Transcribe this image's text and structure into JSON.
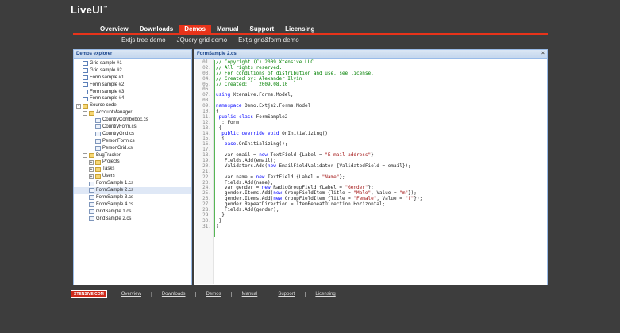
{
  "logo": {
    "text": "LiveUI",
    "sup": "™"
  },
  "topnav": [
    {
      "label": "Overview"
    },
    {
      "label": "Downloads"
    },
    {
      "label": "Demos",
      "active": true
    },
    {
      "label": "Manual"
    },
    {
      "label": "Support"
    },
    {
      "label": "Licensing"
    }
  ],
  "subnav": [
    {
      "label": "Extjs tree demo"
    },
    {
      "label": "JQuery grid demo"
    },
    {
      "label": "Extjs grid&form demo"
    }
  ],
  "explorer": {
    "title": "Demos explorer",
    "nodes": [
      {
        "label": "Grid sample #1",
        "depth": 0,
        "icon": "file",
        "exp": ""
      },
      {
        "label": "Grid sample #2",
        "depth": 0,
        "icon": "file",
        "exp": ""
      },
      {
        "label": "Form sample #1",
        "depth": 0,
        "icon": "file",
        "exp": ""
      },
      {
        "label": "Form sample #2",
        "depth": 0,
        "icon": "file",
        "exp": ""
      },
      {
        "label": "Form sample #3",
        "depth": 0,
        "icon": "file",
        "exp": ""
      },
      {
        "label": "Form sample #4",
        "depth": 0,
        "icon": "file",
        "exp": ""
      },
      {
        "label": "Source code",
        "depth": 0,
        "icon": "folder",
        "exp": "-"
      },
      {
        "label": "AccountManager",
        "depth": 1,
        "icon": "folder",
        "exp": "-"
      },
      {
        "label": "CountryCombobox.cs",
        "depth": 2,
        "icon": "cs",
        "exp": ""
      },
      {
        "label": "CountryForm.cs",
        "depth": 2,
        "icon": "cs",
        "exp": ""
      },
      {
        "label": "CountryGrid.cs",
        "depth": 2,
        "icon": "cs",
        "exp": ""
      },
      {
        "label": "PersonForm.cs",
        "depth": 2,
        "icon": "cs",
        "exp": ""
      },
      {
        "label": "PersonGrid.cs",
        "depth": 2,
        "icon": "cs",
        "exp": ""
      },
      {
        "label": "BugTracker",
        "depth": 1,
        "icon": "folder",
        "exp": "-"
      },
      {
        "label": "Projects",
        "depth": 2,
        "icon": "folder",
        "exp": "+"
      },
      {
        "label": "Tasks",
        "depth": 2,
        "icon": "folder",
        "exp": "+"
      },
      {
        "label": "Users",
        "depth": 2,
        "icon": "folder",
        "exp": "+"
      },
      {
        "label": "FormSample 1.cs",
        "depth": 1,
        "icon": "cs",
        "exp": ""
      },
      {
        "label": "FormSample 2.cs",
        "depth": 1,
        "icon": "cs",
        "exp": "",
        "selected": true
      },
      {
        "label": "FormSample 3.cs",
        "depth": 1,
        "icon": "cs",
        "exp": ""
      },
      {
        "label": "FormSample 4.cs",
        "depth": 1,
        "icon": "cs",
        "exp": ""
      },
      {
        "label": "GridSample 1.cs",
        "depth": 1,
        "icon": "cs",
        "exp": ""
      },
      {
        "label": "GridSample 2.cs",
        "depth": 1,
        "icon": "cs",
        "exp": ""
      }
    ]
  },
  "editor": {
    "title": "FormSample 2.cs",
    "close": "×",
    "lines": [
      {
        "n": "01.",
        "parts": [
          [
            "c-comment",
            "// Copyright (C) 2009 Xtensive LLC."
          ]
        ]
      },
      {
        "n": "02.",
        "parts": [
          [
            "c-comment",
            "// All rights reserved."
          ]
        ]
      },
      {
        "n": "03.",
        "parts": [
          [
            "c-comment",
            "// For conditions of distribution and use, see license."
          ]
        ]
      },
      {
        "n": "04.",
        "parts": [
          [
            "c-comment",
            "// Created by: Alexander Ilyin"
          ]
        ]
      },
      {
        "n": "05.",
        "parts": [
          [
            "c-comment",
            "// Created:    2009.08.10"
          ]
        ]
      },
      {
        "n": "06.",
        "parts": [
          [
            "c-plain",
            ""
          ]
        ]
      },
      {
        "n": "07.",
        "parts": [
          [
            "c-kw",
            "using"
          ],
          [
            "c-plain",
            " Xtensive.Forms.Model;"
          ]
        ]
      },
      {
        "n": "08.",
        "parts": [
          [
            "c-plain",
            ""
          ]
        ]
      },
      {
        "n": "09.",
        "parts": [
          [
            "c-kw",
            "namespace"
          ],
          [
            "c-plain",
            " Demo.Extjs2.Forms.Model"
          ]
        ]
      },
      {
        "n": "10.",
        "parts": [
          [
            "c-plain",
            "{"
          ]
        ]
      },
      {
        "n": "11.",
        "parts": [
          [
            "c-plain",
            " "
          ],
          [
            "c-kw",
            "public"
          ],
          [
            "c-plain",
            " "
          ],
          [
            "c-kw",
            "class"
          ],
          [
            "c-plain",
            " FormSample2"
          ]
        ]
      },
      {
        "n": "12.",
        "parts": [
          [
            "c-plain",
            "  : Form"
          ]
        ]
      },
      {
        "n": "13.",
        "parts": [
          [
            "c-plain",
            " {"
          ]
        ]
      },
      {
        "n": "14.",
        "parts": [
          [
            "c-plain",
            "  "
          ],
          [
            "c-kw",
            "public"
          ],
          [
            "c-plain",
            " "
          ],
          [
            "c-kw",
            "override"
          ],
          [
            "c-plain",
            " "
          ],
          [
            "c-kw",
            "void"
          ],
          [
            "c-plain",
            " OnInitializing()"
          ]
        ]
      },
      {
        "n": "15.",
        "parts": [
          [
            "c-plain",
            "  {"
          ]
        ]
      },
      {
        "n": "16.",
        "parts": [
          [
            "c-plain",
            "   "
          ],
          [
            "c-kw",
            "base"
          ],
          [
            "c-plain",
            ".OnInitializing();"
          ]
        ]
      },
      {
        "n": "17.",
        "parts": [
          [
            "c-plain",
            ""
          ]
        ]
      },
      {
        "n": "18.",
        "parts": [
          [
            "c-plain",
            "   var email = "
          ],
          [
            "c-kw",
            "new"
          ],
          [
            "c-plain",
            " TextField {Label = "
          ],
          [
            "c-str",
            "\"E-mail address\""
          ],
          [
            "c-plain",
            "};"
          ]
        ]
      },
      {
        "n": "19.",
        "parts": [
          [
            "c-plain",
            "   Fields.Add(email);"
          ]
        ]
      },
      {
        "n": "20.",
        "parts": [
          [
            "c-plain",
            "   Validators.Add("
          ],
          [
            "c-kw",
            "new"
          ],
          [
            "c-plain",
            " EmailFieldValidator {ValidatedField = email});"
          ]
        ]
      },
      {
        "n": "21.",
        "parts": [
          [
            "c-plain",
            ""
          ]
        ]
      },
      {
        "n": "22.",
        "parts": [
          [
            "c-plain",
            "   var name = "
          ],
          [
            "c-kw",
            "new"
          ],
          [
            "c-plain",
            " TextField {Label = "
          ],
          [
            "c-str",
            "\"Name\""
          ],
          [
            "c-plain",
            "};"
          ]
        ]
      },
      {
        "n": "23.",
        "parts": [
          [
            "c-plain",
            "   Fields.Add(name);"
          ]
        ]
      },
      {
        "n": "24.",
        "parts": [
          [
            "c-plain",
            "   var gender = "
          ],
          [
            "c-kw",
            "new"
          ],
          [
            "c-plain",
            " RadioGroupField {Label = "
          ],
          [
            "c-str",
            "\"Gender\""
          ],
          [
            "c-plain",
            "};"
          ]
        ]
      },
      {
        "n": "25.",
        "parts": [
          [
            "c-plain",
            "   gender.Items.Add("
          ],
          [
            "c-kw",
            "new"
          ],
          [
            "c-plain",
            " GroupFieldItem {Title = "
          ],
          [
            "c-str",
            "\"Male\""
          ],
          [
            "c-plain",
            ", Value = "
          ],
          [
            "c-str",
            "\"m\""
          ],
          [
            "c-plain",
            "});"
          ]
        ]
      },
      {
        "n": "26.",
        "parts": [
          [
            "c-plain",
            "   gender.Items.Add("
          ],
          [
            "c-kw",
            "new"
          ],
          [
            "c-plain",
            " GroupFieldItem {Title = "
          ],
          [
            "c-str",
            "\"Female\""
          ],
          [
            "c-plain",
            ", Value = "
          ],
          [
            "c-str",
            "\"f\""
          ],
          [
            "c-plain",
            "});"
          ]
        ]
      },
      {
        "n": "27.",
        "parts": [
          [
            "c-plain",
            "   gender.RepeatDirection = ItemRepeatDirection.Horizontal;"
          ]
        ]
      },
      {
        "n": "28.",
        "parts": [
          [
            "c-plain",
            "   Fields.Add(gender);"
          ]
        ]
      },
      {
        "n": "29.",
        "parts": [
          [
            "c-plain",
            "  }"
          ]
        ]
      },
      {
        "n": "30.",
        "parts": [
          [
            "c-plain",
            " }"
          ]
        ]
      },
      {
        "n": "31.",
        "parts": [
          [
            "c-plain",
            "}"
          ]
        ]
      }
    ]
  },
  "footer": {
    "brand": "XTENSIVE.COM",
    "links": [
      {
        "label": "Overview"
      },
      {
        "label": "Downloads"
      },
      {
        "label": "Demos"
      },
      {
        "label": "Manual"
      },
      {
        "label": "Support"
      },
      {
        "label": "Licensing"
      }
    ],
    "separator": "|"
  }
}
